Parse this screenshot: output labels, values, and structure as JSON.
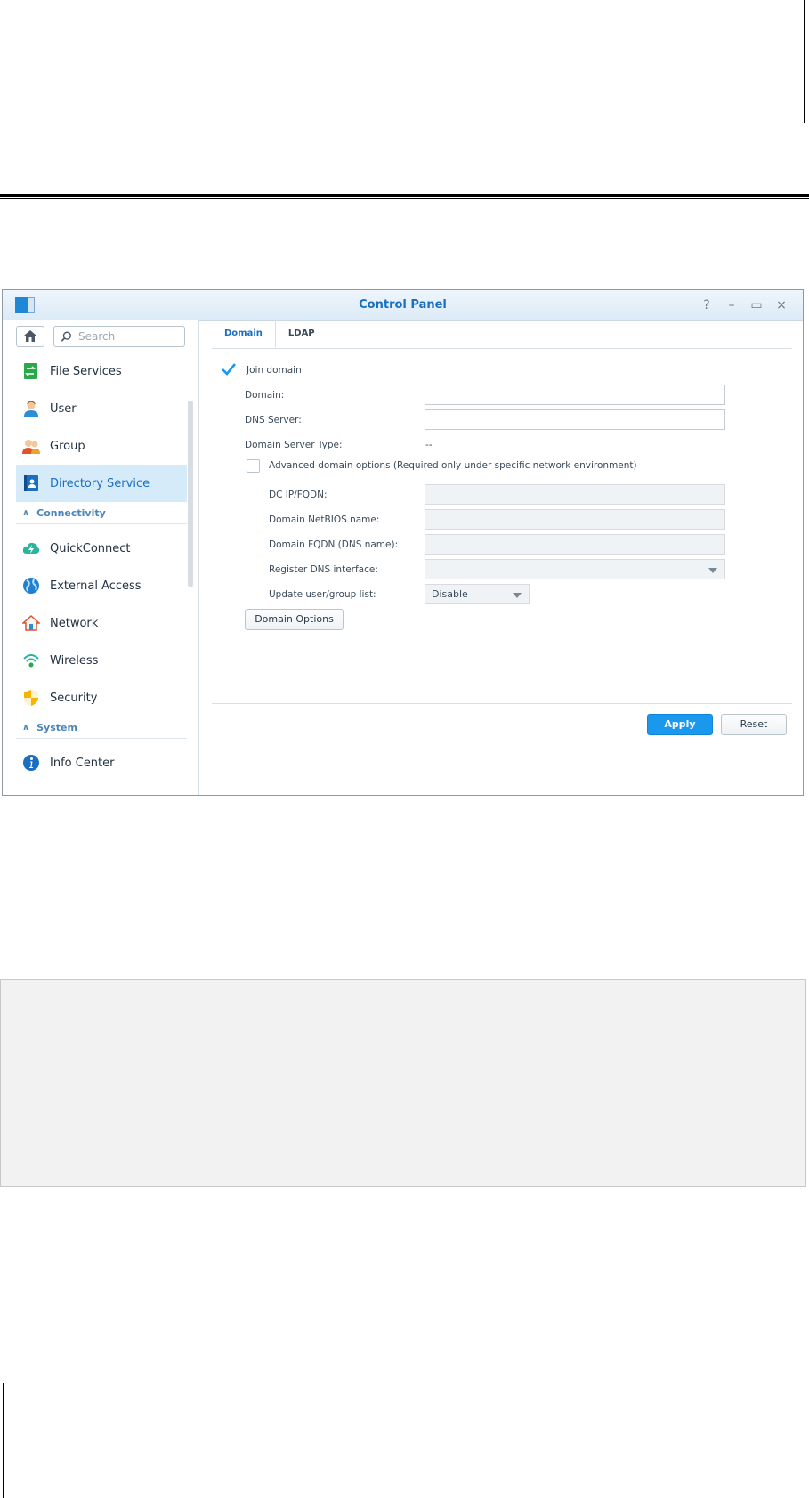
{
  "window": {
    "title": "Control Panel",
    "controls": [
      "?",
      "–",
      "▭",
      "×"
    ]
  },
  "sidebar": {
    "search_placeholder": "Search",
    "items": [
      {
        "label": "File Services",
        "icon": "file-services-icon"
      },
      {
        "label": "User",
        "icon": "user-icon"
      },
      {
        "label": "Group",
        "icon": "group-icon"
      },
      {
        "label": "Directory Service",
        "icon": "directory-service-icon",
        "active": true
      }
    ],
    "section_connectivity": "Connectivity",
    "connectivity_items": [
      {
        "label": "QuickConnect",
        "icon": "quickconnect-icon"
      },
      {
        "label": "External Access",
        "icon": "globe-icon"
      },
      {
        "label": "Network",
        "icon": "network-house-icon"
      },
      {
        "label": "Wireless",
        "icon": "wifi-icon"
      },
      {
        "label": "Security",
        "icon": "shield-icon"
      }
    ],
    "section_system": "System",
    "system_items": [
      {
        "label": "Info Center",
        "icon": "info-icon"
      }
    ]
  },
  "tabs": [
    {
      "label": "Domain",
      "active": true
    },
    {
      "label": "LDAP"
    }
  ],
  "form": {
    "join_domain": "Join domain",
    "domain_label": "Domain:",
    "dns_server_label": "DNS Server:",
    "server_type_label": "Domain Server Type:",
    "server_type_value": "--",
    "advanced_label": "Advanced domain options (Required only under specific network environment)",
    "dc_label": "DC IP/FQDN:",
    "netbios_label": "Domain NetBIOS name:",
    "fqdn_label": "Domain FQDN (DNS name):",
    "dns_interface_label": "Register DNS interface:",
    "update_list_label": "Update user/group list:",
    "update_list_value": "Disable",
    "domain_options_button": "Domain Options"
  },
  "footer": {
    "apply": "Apply",
    "reset": "Reset"
  },
  "colors": {
    "accent": "#1a98ee",
    "title_blue": "#1a6fc1",
    "active_bg": "#d6ebfa"
  }
}
